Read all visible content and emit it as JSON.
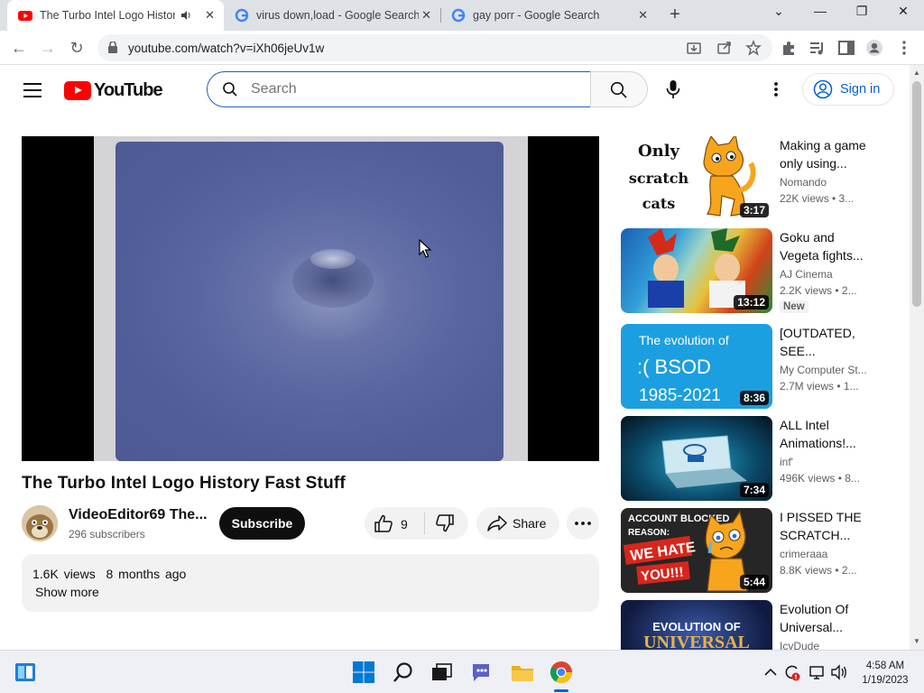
{
  "browser": {
    "tabs": [
      {
        "title": "The Turbo Intel Logo History",
        "active": true
      },
      {
        "title": "virus down,load - Google Search",
        "active": false
      },
      {
        "title": "gay porr - Google Search",
        "active": false
      }
    ],
    "url": "youtube.com/watch?v=iXh06jeUv1w"
  },
  "youtube": {
    "logo_text": "YouTube",
    "search_placeholder": "Search",
    "signin_label": "Sign in"
  },
  "video": {
    "title": "The Turbo Intel Logo History Fast Stuff",
    "channel": "VideoEditor69 The...",
    "subscribers": "296 subscribers",
    "subscribe_label": "Subscribe",
    "likes": "9",
    "share_label": "Share",
    "views": "1.6K views",
    "age": "8 months ago",
    "show_more": "Show more"
  },
  "recommendations": [
    {
      "title_line1": "Making a game",
      "title_line2": "only using...",
      "channel": "Nomando",
      "stats": "22K views  •  3...",
      "duration": "3:17",
      "badge": "",
      "thumb_text": [
        "Only",
        "scratch",
        "cats"
      ]
    },
    {
      "title_line1": "Goku and",
      "title_line2": "Vegeta fights...",
      "channel": "AJ Cinema",
      "stats": "2.2K views  •  2...",
      "duration": "13:12",
      "badge": "New"
    },
    {
      "title_line1": "[OUTDATED,",
      "title_line2": "SEE...",
      "channel": "My Computer St...",
      "stats": "2.7M views  •  1...",
      "duration": "8:36",
      "badge": "",
      "thumb_text": [
        "The evolution of",
        ":( BSOD",
        "1985-2021"
      ]
    },
    {
      "title_line1": "ALL Intel",
      "title_line2": "Animations!...",
      "channel": "inf'",
      "stats": "496K views  •  8...",
      "duration": "7:34",
      "badge": ""
    },
    {
      "title_line1": "I PISSED THE",
      "title_line2": "SCRATCH...",
      "channel": "crimeraaa",
      "stats": "8.8K views  •  2...",
      "duration": "5:44",
      "badge": "",
      "thumb_text": [
        "ACCOUNT BLOCKED",
        "REASON:",
        "WE HATE",
        "YOU!!!"
      ]
    },
    {
      "title_line1": "Evolution Of",
      "title_line2": "Universal...",
      "channel": "IcyDude",
      "stats": "",
      "duration": "",
      "badge": "",
      "thumb_text": [
        "EVOLUTION OF",
        "UNIVERSAL"
      ]
    }
  ],
  "taskbar": {
    "time": "4:58 AM",
    "date": "1/19/2023"
  },
  "colors": {
    "youtube_red": "#ff0000",
    "link_blue": "#065fd4",
    "tab_strip": "#dee1e6"
  }
}
